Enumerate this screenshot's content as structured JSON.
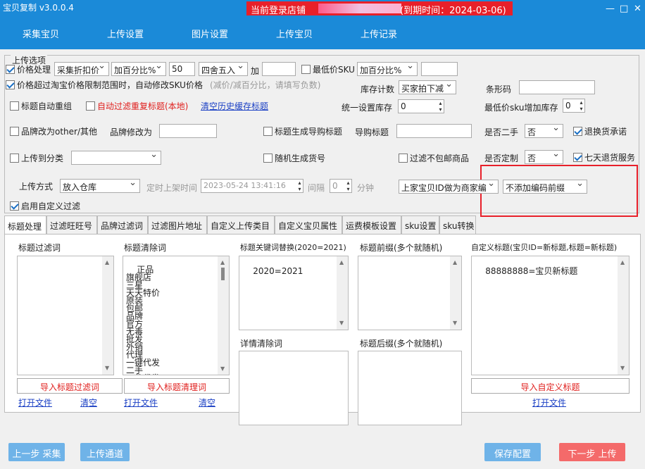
{
  "title_bar": {
    "app_title": "宝贝复制 v3.0.0.4",
    "login_label": "当前登录店铺",
    "expire_text": "(到期时间：2024-03-06)",
    "minimize": "—",
    "maximize": "□",
    "close": "✕"
  },
  "nav": {
    "tabs": [
      "采集宝贝",
      "上传设置",
      "图片设置",
      "上传宝贝",
      "上传记录"
    ],
    "active_tab": "上传设置"
  },
  "upload_options": {
    "group_title": "上传选项",
    "price_processing": {
      "label": "价格处理",
      "checked": true
    },
    "price_mode_select": "采集折扣价",
    "price_method_select": "加百分比%",
    "price_value": "50",
    "rounding_select": "四舍五入",
    "plus_label": "加",
    "plus_value": "",
    "min_price_sku": {
      "label": "最低价SKU",
      "checked": false
    },
    "min_price_method_select": "加百分比%",
    "min_price_value": "",
    "auto_modify_sku": {
      "label": "价格超过淘宝价格限制范围时，自动修改SKU价格",
      "checked": true
    },
    "auto_modify_hint": "(减价/减百分比，请填写负数)",
    "stock_count_label": "库存计数",
    "stock_count_select": "买家拍下减",
    "barcode_label": "条形码",
    "barcode_value": "",
    "title_auto_regroup": {
      "label": "标题自动重组",
      "checked": false
    },
    "auto_filter_dup": {
      "label": "自动过滤重复标题(本地)",
      "checked": false
    },
    "clear_history_link": "清空历史缓存标题",
    "unified_stock_label": "统一设置库存",
    "unified_stock_value": "0",
    "min_sku_stock_label": "最低价sku增加库存",
    "min_sku_stock_value": "0",
    "brand_change": {
      "label": "品牌改为other/其他",
      "checked": false
    },
    "brand_change_to_label": "品牌修改为",
    "brand_change_to_value": "",
    "title_gen_guide": {
      "label": "标题生成导购标题",
      "checked": false
    },
    "guide_title_label": "导购标题",
    "guide_title_value": "",
    "second_hand_label": "是否二手",
    "second_hand_select": "否",
    "return_promise": {
      "label": "退换货承诺",
      "checked": true
    },
    "upload_to_category": {
      "label": "上传到分类",
      "checked": false
    },
    "category_select": "",
    "random_item_no": {
      "label": "随机生成货号",
      "checked": false
    },
    "filter_no_shipping": {
      "label": "过滤不包邮商品",
      "checked": false
    },
    "customized_label": "是否定制",
    "customized_select": "否",
    "seven_day_return": {
      "label": "七天退货服务",
      "checked": true
    },
    "upload_method_label": "上传方式",
    "upload_method_select": "放入仓库",
    "scheduled_label": "定时上架时间",
    "scheduled_value": "2023-05-24  13:41:16",
    "interval_label": "间隔",
    "interval_value": "0",
    "minute_label": "分钟",
    "merchant_code_select": "上家宝贝ID做为商家编",
    "prefix_select": "不添加编码前缀",
    "enable_custom_filter": {
      "label": "启用自定义过滤",
      "checked": true
    }
  },
  "tabs": {
    "items": [
      "标题处理",
      "过滤旺旺号",
      "品牌过滤词",
      "过滤图片地址",
      "自定义上传类目",
      "自定义宝贝属性",
      "运费模板设置",
      "sku设置",
      "sku转换"
    ],
    "active": "标题处理"
  },
  "title_panel": {
    "filter_words": {
      "label": "标题过滤词",
      "content": "",
      "import_btn": "导入标题过滤词",
      "open_link": "打开文件",
      "clear_link": "清空"
    },
    "clean_words": {
      "label": "标题清除词",
      "content": "正品\n旗舰店\n三星\n天天特价\n原装\n包邮\n品牌\n官方\n无毒\n批发\n外销\n代理\n一键代发\n二手\n一件代发",
      "import_btn": "导入标题清理词",
      "open_link": "打开文件",
      "clear_link": "清空"
    },
    "keyword_replace": {
      "label": "标题关键词替换(2020=2021)",
      "content": "2020=2021"
    },
    "detail_clear": {
      "label": "详情清除词",
      "content": ""
    },
    "prefix": {
      "label": "标题前缀(多个就随机)",
      "content": ""
    },
    "suffix": {
      "label": "标题后缀(多个就随机)",
      "content": ""
    },
    "custom_title": {
      "label": "自定义标题(宝贝ID=新标题,标题=新标题)",
      "content": "88888888=宝贝新标题",
      "import_btn": "导入自定义标题",
      "open_link": "打开文件"
    }
  },
  "footer": {
    "prev_btn": "上一步 采集",
    "channel_btn": "上传通道",
    "save_btn": "保存配置",
    "next_btn": "下一步 上传"
  },
  "colors": {
    "brand_blue": "#1b8ad8",
    "alert_red": "#e8202a",
    "link_blue": "#1a3fc4"
  }
}
